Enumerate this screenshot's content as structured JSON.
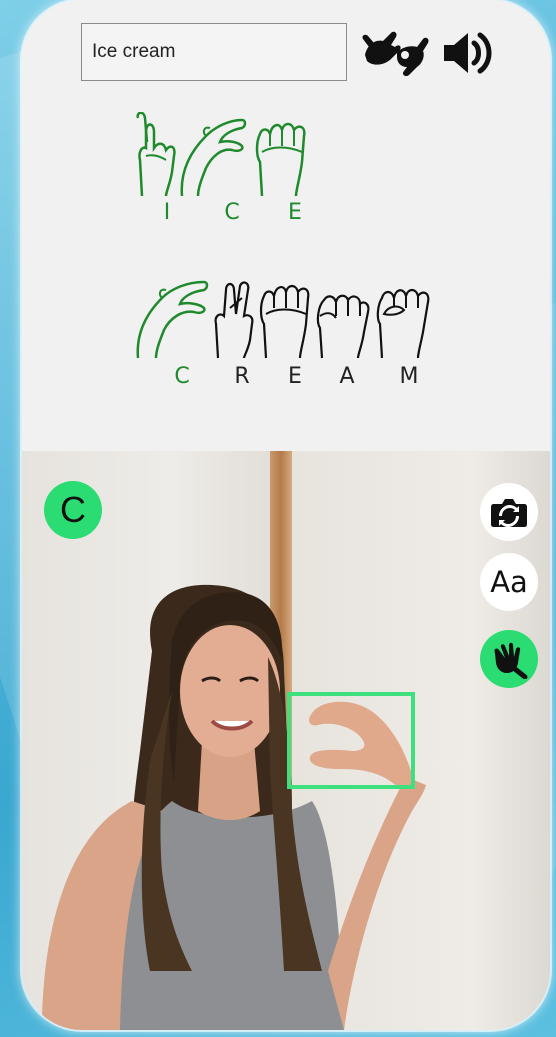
{
  "search": {
    "value": "Ice cream"
  },
  "toolbar": {
    "sign_icon": "sign-language-icon",
    "speaker_icon": "speaker-volume-icon"
  },
  "sign_display": {
    "word1_letters": [
      "I",
      "C",
      "E"
    ],
    "word2_letters": [
      "C",
      "R",
      "E",
      "A",
      "M"
    ]
  },
  "camera": {
    "detected_letter": "C",
    "text_mode_label": "Aa",
    "flip_icon": "camera-flip-icon",
    "sign_mode_icon": "hand-sign-icon"
  },
  "colors": {
    "accent_green": "#2bdc72",
    "sign_green": "#1f8a2c",
    "detect_box": "#3de07c"
  }
}
